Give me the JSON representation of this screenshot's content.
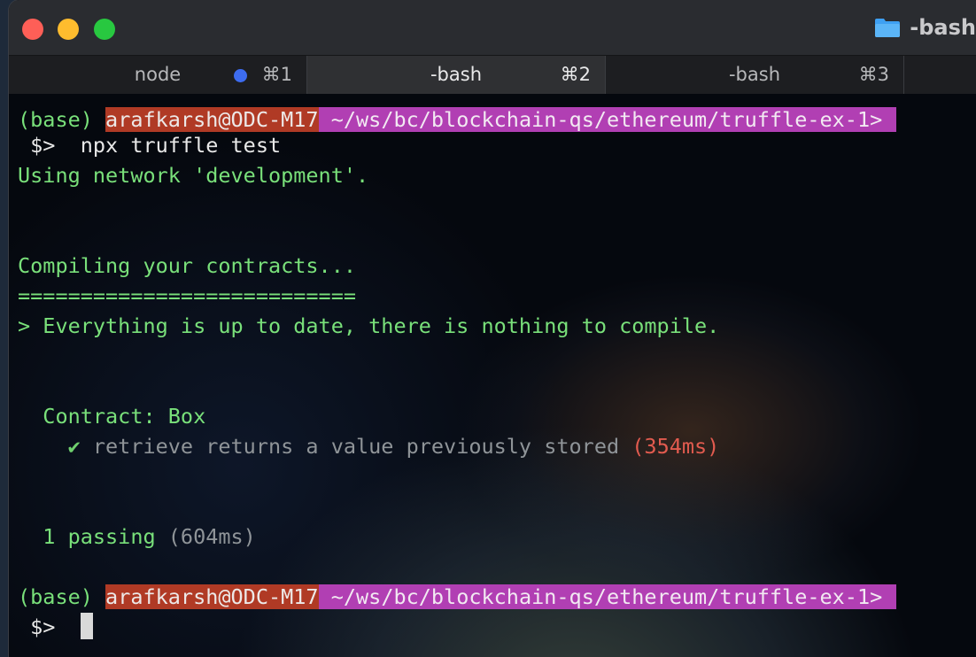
{
  "window": {
    "title": "-bash"
  },
  "tabs": [
    {
      "label": "node",
      "shortcut": "⌘1"
    },
    {
      "label": "-bash",
      "shortcut": "⌘2"
    },
    {
      "label": "-bash",
      "shortcut": "⌘3"
    }
  ],
  "terminal": {
    "prompt1": {
      "env": "(base) ",
      "user": "arafkarsh@ODC-M17",
      "path": " ~/ws/bc/blockchain-qs/ethereum/truffle-ex-1>"
    },
    "command_prompt": " $> ",
    "command": " npx truffle test",
    "network_line": "Using network 'development'.",
    "compiling_line": "Compiling your contracts...",
    "separator_line": "===========================",
    "up_to_date_line": "> Everything is up to date, there is nothing to compile.",
    "contract_line": "  Contract: Box",
    "test_check": "    ✔ ",
    "test_name": "retrieve returns a value previously stored",
    "test_time": " (354ms)",
    "passing_count": "  1 passing",
    "passing_time": " (604ms)",
    "prompt2": {
      "env": "(base) ",
      "user": "arafkarsh@ODC-M17",
      "path": " ~/ws/bc/blockchain-qs/ethereum/truffle-ex-1>"
    },
    "final_prompt": " $>  "
  },
  "colors": {
    "output_green": "#79e07a",
    "user_segment": "#b03a25",
    "path_segment": "#b13fb3",
    "tab_indicator": "#3d6cf0"
  }
}
